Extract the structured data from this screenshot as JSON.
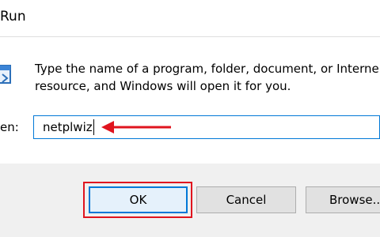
{
  "window": {
    "title": "Run"
  },
  "description": {
    "line1": "Type the name of a program, folder, document, or Interne",
    "line2": "resource, and Windows will open it for you."
  },
  "open_field": {
    "label": "en:",
    "value": "netplwiz"
  },
  "buttons": {
    "ok_label": "OK",
    "cancel_label": "Cancel",
    "browse_label": "Browse..."
  },
  "icons": {
    "run_icon": "run-program-icon",
    "arrow": "red-arrow-pointer-icon"
  },
  "colors": {
    "accent": "#0078d7",
    "annotation": "#e0141e",
    "button_area": "#f0f0f0"
  }
}
